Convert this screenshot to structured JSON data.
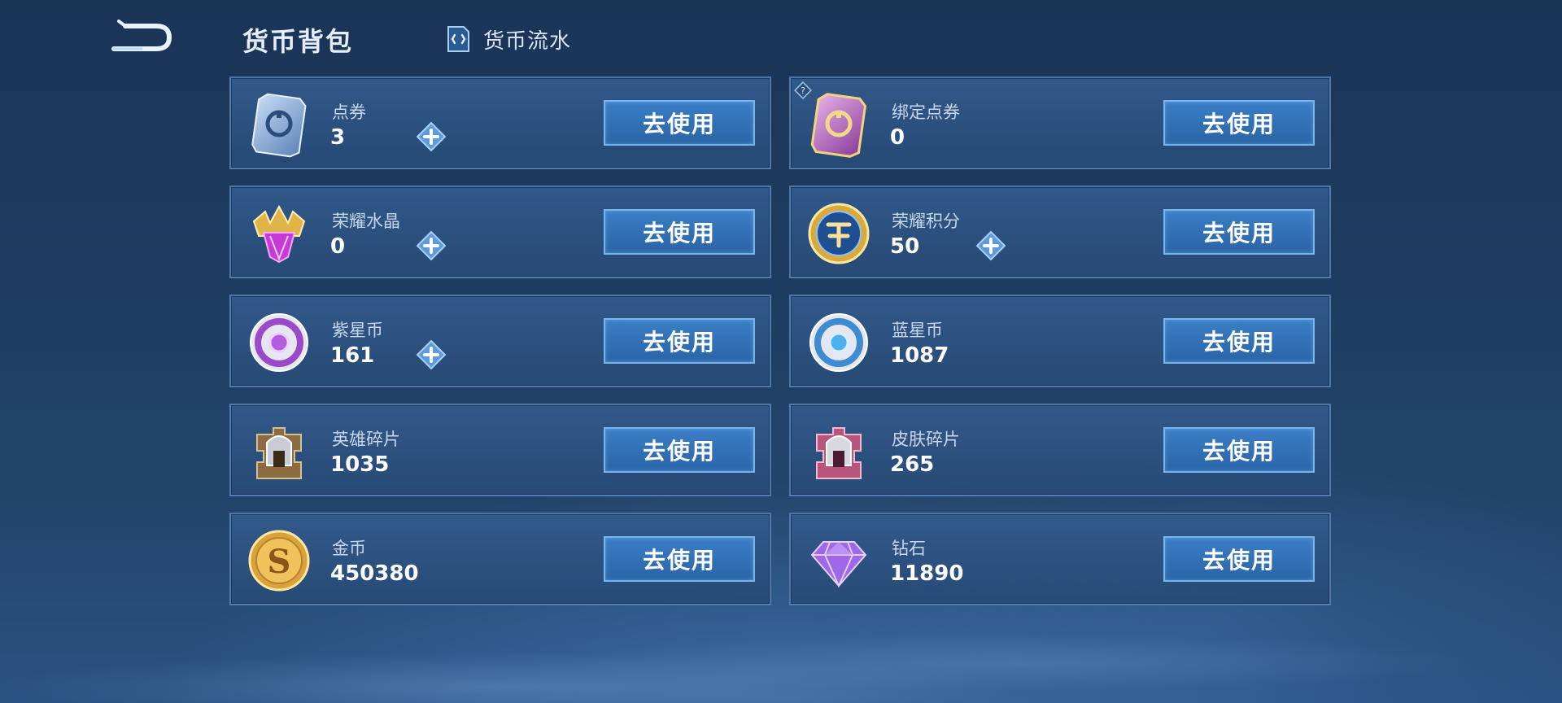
{
  "header": {
    "title": "货币背包",
    "history_label": "货币流水"
  },
  "cards": [
    {
      "name": "点券",
      "value": "3",
      "button": "去使用",
      "icon": "voucher-card-icon",
      "has_plus": true
    },
    {
      "name": "绑定点券",
      "value": "0",
      "button": "去使用",
      "icon": "bound-voucher-card-icon",
      "has_plus": false,
      "has_help": true
    },
    {
      "name": "荣耀水晶",
      "value": "0",
      "button": "去使用",
      "icon": "glory-crystal-icon",
      "has_plus": true
    },
    {
      "name": "荣耀积分",
      "value": "50",
      "button": "去使用",
      "icon": "glory-points-coin-icon",
      "has_plus": true
    },
    {
      "name": "紫星币",
      "value": "161",
      "button": "去使用",
      "icon": "purple-star-coin-icon",
      "has_plus": true
    },
    {
      "name": "蓝星币",
      "value": "1087",
      "button": "去使用",
      "icon": "blue-star-coin-icon",
      "has_plus": false
    },
    {
      "name": "英雄碎片",
      "value": "1035",
      "button": "去使用",
      "icon": "hero-fragment-icon",
      "has_plus": false
    },
    {
      "name": "皮肤碎片",
      "value": "265",
      "button": "去使用",
      "icon": "skin-fragment-icon",
      "has_plus": false
    },
    {
      "name": "金币",
      "value": "450380",
      "button": "去使用",
      "icon": "gold-coin-icon",
      "has_plus": false
    },
    {
      "name": "钻石",
      "value": "11890",
      "button": "去使用",
      "icon": "diamond-icon",
      "has_plus": false
    }
  ]
}
